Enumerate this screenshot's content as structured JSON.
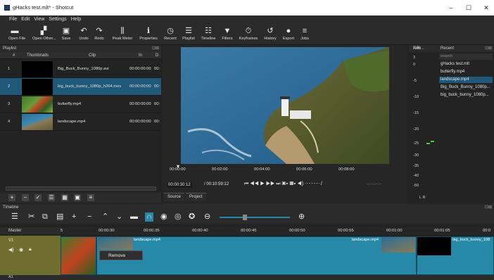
{
  "window": {
    "title": "gHacks test.mlt* - Shotcut"
  },
  "menu": [
    "File",
    "Edit",
    "View",
    "Settings",
    "Help"
  ],
  "toolbar": [
    {
      "label": "Open File",
      "icon": "folder-icon",
      "glyph": "▬"
    },
    {
      "label": "Open Other...",
      "icon": "open-other-icon",
      "glyph": "▞"
    },
    {
      "label": "Save",
      "icon": "save-icon",
      "glyph": "▣"
    },
    {
      "label": "Undo",
      "icon": "undo-icon",
      "glyph": "↶"
    },
    {
      "label": "Redo",
      "icon": "redo-icon",
      "glyph": "↷"
    },
    {
      "label": "Peak Meter",
      "icon": "peak-meter-icon",
      "glyph": "⫼"
    },
    {
      "label": "Properties",
      "icon": "info-icon",
      "glyph": "ℹ"
    },
    {
      "label": "Recent",
      "icon": "clock-icon",
      "glyph": "◷"
    },
    {
      "label": "Playlist",
      "icon": "list-icon",
      "glyph": "☰"
    },
    {
      "label": "Timeline",
      "icon": "timeline-icon",
      "glyph": "☷"
    },
    {
      "label": "Filters",
      "icon": "filter-icon",
      "glyph": "▼"
    },
    {
      "label": "Keyframes",
      "icon": "stopwatch-icon",
      "glyph": "⏱"
    },
    {
      "label": "History",
      "icon": "history-icon",
      "glyph": "↺"
    },
    {
      "label": "Export",
      "icon": "export-icon",
      "glyph": "●"
    },
    {
      "label": "Jobs",
      "icon": "jobs-icon",
      "glyph": "≡"
    }
  ],
  "playlist": {
    "title": "Playlist",
    "columns": [
      "#",
      "Thumbnails",
      "Clip",
      "In",
      "D"
    ],
    "rows": [
      {
        "num": "1",
        "clip": "Big_Buck_Bunny_1080p.avi",
        "in": "00:00:00:00",
        "d": "00:"
      },
      {
        "num": "2",
        "clip": "big_buck_bunny_1080p_h264.mov",
        "in": "00:00:00:00",
        "d": "00:"
      },
      {
        "num": "3",
        "clip": "butterfly.mp4",
        "in": "00:00:00:00",
        "d": "00:"
      },
      {
        "num": "4",
        "clip": "landscape.mp4",
        "in": "00:00:00:00",
        "d": "00:"
      }
    ]
  },
  "viewer": {
    "ruler_ticks": [
      "00:00:00",
      "00:02:00",
      "00:04:00",
      "00:06:00",
      "00:08:00"
    ],
    "current_time": "00:00:30:12",
    "total_time": "/ 00:10:59:12",
    "tabs": [
      "Source",
      "Project"
    ]
  },
  "audio": {
    "title": "Audi...",
    "scale": [
      "3",
      "0",
      "-5",
      "-10",
      "-15",
      "-20",
      "-25",
      "-30",
      "-35",
      "-40",
      "-50"
    ],
    "channels": "L R"
  },
  "recent": {
    "title": "Recent",
    "placeholder": "search",
    "items": [
      "gHacks test.mlt",
      "butterfly.mp4",
      "landscape.mp4",
      "Big_Buck_Bunny_1080p...",
      "big_buck_bunny_1080p..."
    ]
  },
  "timeline": {
    "title": "Timeline",
    "master_label": "Master",
    "track_name": "V1",
    "ruler": [
      "5",
      "00:00:30",
      "00:00:35",
      "00:00:40",
      "00:00:45",
      "00:00:50",
      "00:00:55",
      "00:01:00",
      "00:01:05",
      "00:0"
    ],
    "clips": [
      "landscape.mp4",
      "landscape.mp4",
      "big_buck_bunny_108"
    ],
    "context_menu": "Remove",
    "bottom_track": "A1"
  },
  "colors": {
    "accent": "#2789a8",
    "selected_row": "#1f5878",
    "track_head": "#6f6e2e"
  }
}
